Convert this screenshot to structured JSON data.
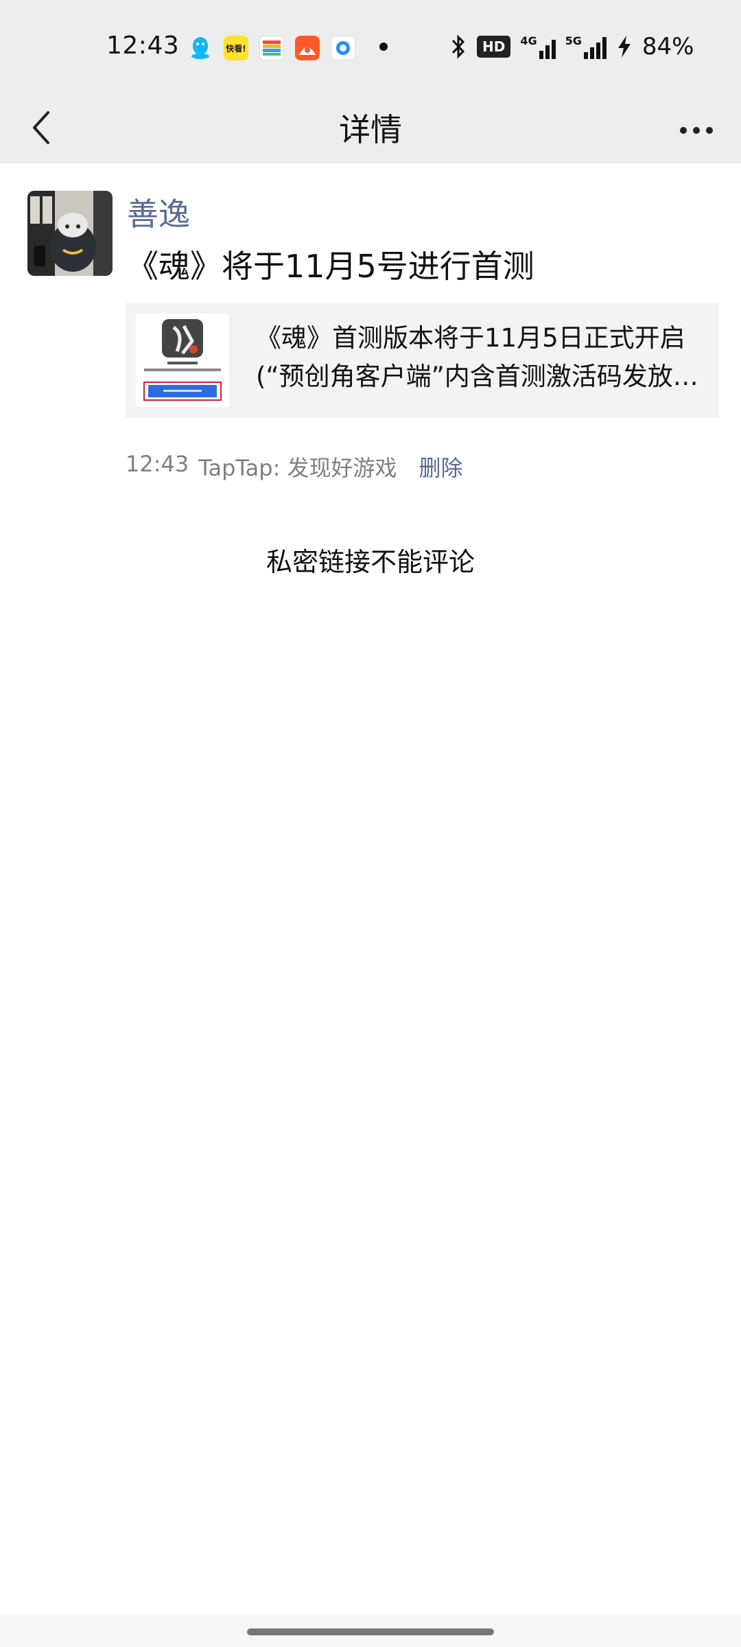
{
  "status_bar": {
    "time": "12:43",
    "battery": "84%",
    "hd_label": "HD",
    "net1": "4G",
    "net2": "5G",
    "apps": [
      {
        "name": "qq-icon",
        "label": ""
      },
      {
        "name": "kuaishou-icon",
        "label": "快看!"
      },
      {
        "name": "wallet-icon",
        "label": ""
      },
      {
        "name": "music-icon",
        "label": ""
      },
      {
        "name": "browser-icon",
        "label": ""
      }
    ]
  },
  "navbar": {
    "title": "详情"
  },
  "post": {
    "author": "善逸",
    "text": "《魂》将于11月5号进行首测",
    "link": {
      "title": "《魂》首测版本将于11月5日正式开启(“预创角客户端”内含首测激活码发放…"
    },
    "meta": {
      "time": "12:43",
      "source": "TapTap: 发现好游戏",
      "delete_label": "删除"
    },
    "private_note": "私密链接不能评论"
  },
  "colors": {
    "link_blue": "#576b95",
    "bar_bg": "#ededed"
  }
}
